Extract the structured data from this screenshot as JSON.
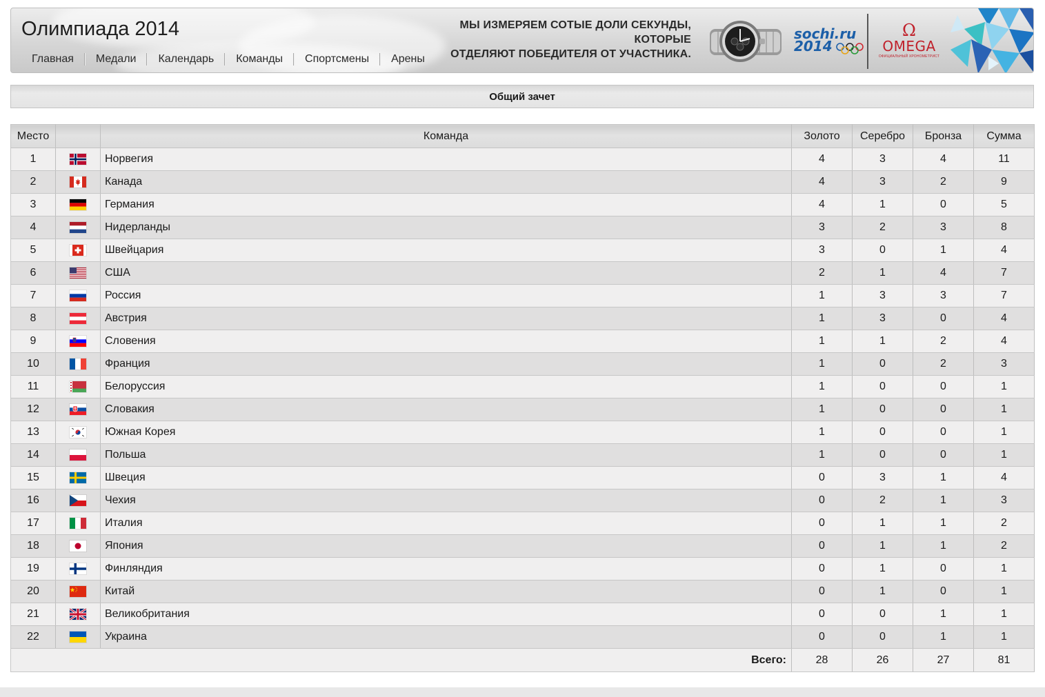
{
  "header": {
    "site_title": "Олимпиада 2014",
    "nav": [
      "Главная",
      "Медали",
      "Календарь",
      "Команды",
      "Спортсмены",
      "Арены"
    ],
    "promo_line1": "МЫ ИЗМЕРЯЕМ СОТЫЕ ДОЛИ СЕКУНДЫ, КОТОРЫЕ",
    "promo_line2": "ОТДЕЛЯЮТ ПОБЕДИТЕЛЯ ОТ УЧАСТНИКА.",
    "sochi_logo_line1": "sochi.ru",
    "sochi_logo_line2": "2014",
    "omega_symbol": "Ω",
    "omega_name": "OMEGA",
    "omega_sub": "ОФИЦИАЛЬНЫЙ ХРОНОМЕТРИСТ"
  },
  "section_title": "Общий зачет",
  "table": {
    "columns": {
      "place": "Место",
      "flag": "",
      "team": "Команда",
      "gold": "Золото",
      "silver": "Серебро",
      "bronze": "Бронза",
      "total": "Сумма"
    },
    "rows": [
      {
        "place": "1",
        "team": "Норвегия",
        "flag": "norway",
        "gold": "4",
        "silver": "3",
        "bronze": "4",
        "total": "11"
      },
      {
        "place": "2",
        "team": "Канада",
        "flag": "canada",
        "gold": "4",
        "silver": "3",
        "bronze": "2",
        "total": "9"
      },
      {
        "place": "3",
        "team": "Германия",
        "flag": "germany",
        "gold": "4",
        "silver": "1",
        "bronze": "0",
        "total": "5"
      },
      {
        "place": "4",
        "team": "Нидерланды",
        "flag": "netherlands",
        "gold": "3",
        "silver": "2",
        "bronze": "3",
        "total": "8"
      },
      {
        "place": "5",
        "team": "Швейцария",
        "flag": "switzerland",
        "gold": "3",
        "silver": "0",
        "bronze": "1",
        "total": "4"
      },
      {
        "place": "6",
        "team": "США",
        "flag": "usa",
        "gold": "2",
        "silver": "1",
        "bronze": "4",
        "total": "7"
      },
      {
        "place": "7",
        "team": "Россия",
        "flag": "russia",
        "gold": "1",
        "silver": "3",
        "bronze": "3",
        "total": "7"
      },
      {
        "place": "8",
        "team": "Австрия",
        "flag": "austria",
        "gold": "1",
        "silver": "3",
        "bronze": "0",
        "total": "4"
      },
      {
        "place": "9",
        "team": "Словения",
        "flag": "slovenia",
        "gold": "1",
        "silver": "1",
        "bronze": "2",
        "total": "4"
      },
      {
        "place": "10",
        "team": "Франция",
        "flag": "france",
        "gold": "1",
        "silver": "0",
        "bronze": "2",
        "total": "3"
      },
      {
        "place": "11",
        "team": "Белоруссия",
        "flag": "belarus",
        "gold": "1",
        "silver": "0",
        "bronze": "0",
        "total": "1"
      },
      {
        "place": "12",
        "team": "Словакия",
        "flag": "slovakia",
        "gold": "1",
        "silver": "0",
        "bronze": "0",
        "total": "1"
      },
      {
        "place": "13",
        "team": "Южная Корея",
        "flag": "south-korea",
        "gold": "1",
        "silver": "0",
        "bronze": "0",
        "total": "1"
      },
      {
        "place": "14",
        "team": "Польша",
        "flag": "poland",
        "gold": "1",
        "silver": "0",
        "bronze": "0",
        "total": "1"
      },
      {
        "place": "15",
        "team": "Швеция",
        "flag": "sweden",
        "gold": "0",
        "silver": "3",
        "bronze": "1",
        "total": "4"
      },
      {
        "place": "16",
        "team": "Чехия",
        "flag": "czech",
        "gold": "0",
        "silver": "2",
        "bronze": "1",
        "total": "3"
      },
      {
        "place": "17",
        "team": "Италия",
        "flag": "italy",
        "gold": "0",
        "silver": "1",
        "bronze": "1",
        "total": "2"
      },
      {
        "place": "18",
        "team": "Япония",
        "flag": "japan",
        "gold": "0",
        "silver": "1",
        "bronze": "1",
        "total": "2"
      },
      {
        "place": "19",
        "team": "Финляндия",
        "flag": "finland",
        "gold": "0",
        "silver": "1",
        "bronze": "0",
        "total": "1"
      },
      {
        "place": "20",
        "team": "Китай",
        "flag": "china",
        "gold": "0",
        "silver": "1",
        "bronze": "0",
        "total": "1"
      },
      {
        "place": "21",
        "team": "Великобритания",
        "flag": "great-britain",
        "gold": "0",
        "silver": "0",
        "bronze": "1",
        "total": "1"
      },
      {
        "place": "22",
        "team": "Украина",
        "flag": "ukraine",
        "gold": "0",
        "silver": "0",
        "bronze": "1",
        "total": "1"
      }
    ],
    "totals": {
      "label": "Всего:",
      "gold": "28",
      "silver": "26",
      "bronze": "27",
      "total": "81"
    }
  }
}
